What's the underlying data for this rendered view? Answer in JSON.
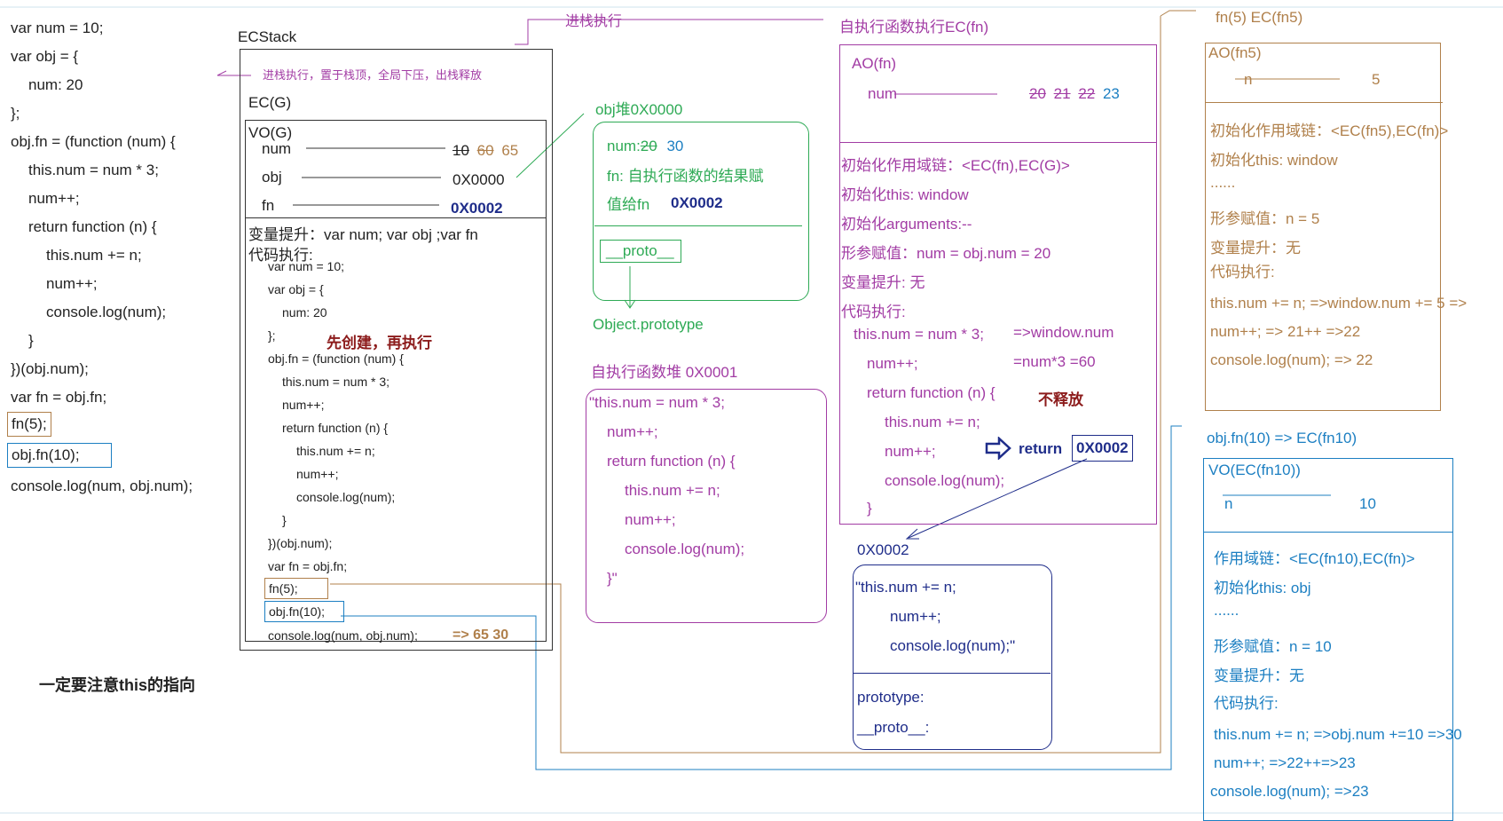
{
  "left_code": [
    "var num = 10;",
    "var obj = {",
    "num: 20",
    "};",
    "obj.fn = (function (num) {",
    "this.num = num * 3;",
    "num++;",
    "return function (n) {",
    "this.num += n;",
    "num++;",
    "console.log(num);",
    "}",
    "})(obj.num);",
    "var fn = obj.fn;",
    "fn(5);",
    "obj.fn(10);",
    "console.log(num, obj.num);"
  ],
  "note_this": "一定要注意this的指向",
  "ecstack": {
    "title": "ECStack",
    "push_note": "进栈执行，置于栈顶，全局下压，出栈释放",
    "ecg_label": "EC(G)",
    "vo_label": "VO(G)",
    "vars": [
      {
        "name": "num",
        "values": [
          "10",
          "60",
          "65"
        ]
      },
      {
        "name": "obj",
        "values": [
          "0X0000"
        ]
      },
      {
        "name": "fn",
        "values": [
          "0X0002"
        ]
      }
    ],
    "hoist": "变量提升：var num; var obj ;var fn",
    "exec_label": "代码执行:",
    "code": [
      "var num = 10;",
      "var obj = {",
      "num: 20",
      "};",
      "obj.fn = (function (num) {",
      "this.num = num * 3;",
      "num++;",
      "return function (n) {",
      "this.num += n;",
      "num++;",
      "console.log(num);",
      "}",
      "})(obj.num);",
      "var fn = obj.fn;",
      "fn(5);",
      "obj.fn(10);",
      "console.log(num, obj.num);"
    ],
    "result": "=> 65 30",
    "create_note": "先创建，再执行"
  },
  "push_exec_label": "进栈执行",
  "obj_heap": {
    "title": "obj堆0X0000",
    "num_line": "num:",
    "num_old": "20",
    "num_new": "30",
    "fn_line1": "fn: 自执行函数的结果赋",
    "fn_line2": "值给fn",
    "fn_value": "0X0002",
    "proto": "__proto__",
    "object_proto": "Object.prototype"
  },
  "iife_heap": {
    "title": "自执行函数堆 0X0001",
    "code": [
      "\"this.num = num * 3;",
      "num++;",
      "return function (n) {",
      "this.num += n;",
      "num++;",
      "console.log(num);",
      "}\""
    ]
  },
  "iife_ec": {
    "title": "自执行函数执行EC(fn)",
    "ao_label": "AO(fn)",
    "num_name": "num",
    "num_values": [
      "20",
      "21",
      "22",
      "23"
    ],
    "lines": [
      "初始化作用域链：<EC(fn),EC(G)>",
      "初始化this: window",
      "初始化arguments:--",
      "形参赋值：num = obj.num = 20",
      "变量提升: 无",
      "代码执行:"
    ],
    "code": [
      "this.num = num * 3;",
      "num++;",
      "return function (n) {",
      "this.num += n;",
      "num++;",
      "console.log(num);",
      "}"
    ],
    "note_window": "=>window.num",
    "note_calc": "=num*3 =60",
    "not_release": "不释放",
    "return_label": "return",
    "return_addr": "0X0002"
  },
  "fn_heap": {
    "title": "0X0002",
    "code": [
      "\"this.num += n;",
      "num++;",
      "console.log(num);\""
    ],
    "prototype": "prototype:",
    "proto": "__proto__:"
  },
  "fn5": {
    "title": "fn(5)   EC(fn5)",
    "ao_label": "AO(fn5)",
    "n_name": "n",
    "n_value": "5",
    "lines": [
      "初始化作用域链：<EC(fn5),EC(fn)>",
      "初始化this: window",
      "......",
      "形参赋值：n = 5",
      "变量提升：无",
      "代码执行:",
      "this.num += n;  =>window.num += 5 =>",
      "num++;   => 21++ =>22",
      "console.log(num);  => 22"
    ]
  },
  "fn10": {
    "title": "obj.fn(10) => EC(fn10)",
    "vo_label": "VO(EC(fn10))",
    "n_name": "n",
    "n_value": "10",
    "lines": [
      "作用域链：<EC(fn10),EC(fn)>",
      "初始化this: obj",
      "......",
      "形参赋值：n = 10",
      "变量提升：无",
      "代码执行:",
      "this.num += n; =>obj.num +=10 =>30",
      "num++;  =>22++=>23",
      "console.log(num);  =>23"
    ]
  },
  "colors": {
    "green": "#2eaa55",
    "purple": "#a23ca4",
    "blue": "#1c7fc2",
    "brown": "#b0804b",
    "navy": "#1f2d8a",
    "dark_red": "#8c1b1b"
  }
}
